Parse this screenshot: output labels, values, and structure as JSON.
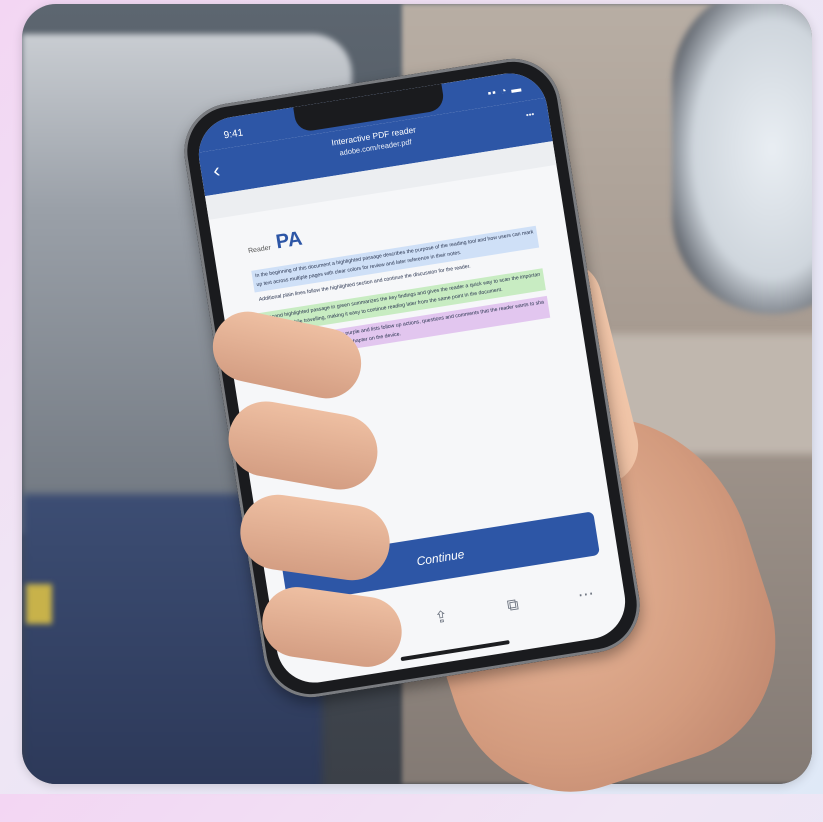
{
  "phone": {
    "status_time": "9:41",
    "status_signal": "▪▪ ◔ ▬",
    "header_title": "Interactive PDF reader",
    "header_subtitle": "adobe.com/reader.pdf",
    "menu_label": "•••",
    "doc_label": "Reader",
    "doc_heading": "PA",
    "paragraphs": [
      {
        "color": "blue",
        "text": "In the beginning of this document a highlighted passage describes the purpose of the reading tool and how users can mark up text across multiple pages with clear colors for review and later reference in their notes."
      },
      {
        "color": "plain",
        "text": "Additional plain lines follow the highlighted section and continue the discussion for the reader."
      },
      {
        "color": "green",
        "text": "A second highlighted passage in green summarizes the key findings and gives the reader a quick way to scan the important sentences while travelling, making it easy to continue reading later from the same point in the document."
      },
      {
        "color": "purple",
        "text": "The third passage is highlighted in purple and lists follow up actions, questions and comments that the reader wants to share with colleagues after finishing the chapter on the device."
      }
    ],
    "cta_label": "Continue",
    "toolbar": {
      "back_icon": "chevron-left-icon",
      "forward_icon": "chevron-right-icon",
      "share_icon": "share-icon",
      "tabs_icon": "tabs-icon",
      "more_label": "⋯"
    }
  }
}
